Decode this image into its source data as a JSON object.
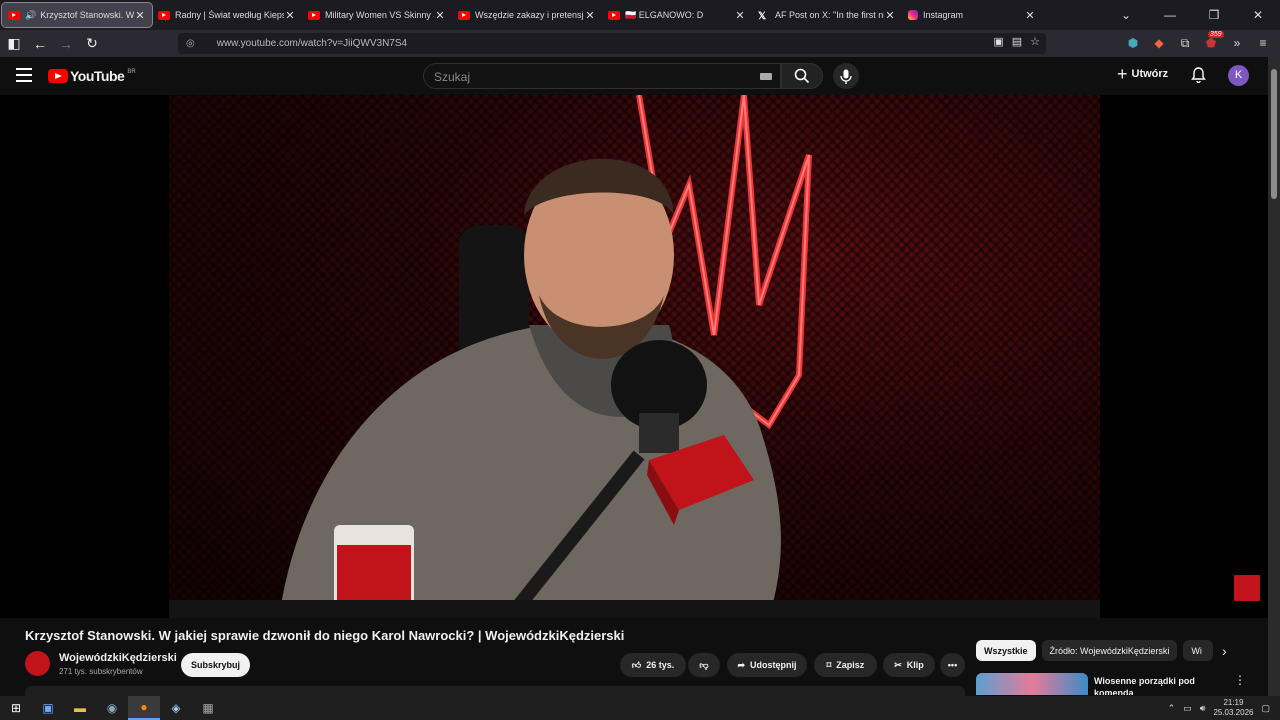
{
  "browser": {
    "tabs": [
      {
        "title": "Krzysztof Stanowski. W jaki",
        "icon": "youtube-icon",
        "active": true,
        "audio": true
      },
      {
        "title": "Radny | Świat według Kiepskich",
        "icon": "youtube-icon"
      },
      {
        "title": "Military Women VS Skinny Joes",
        "icon": "youtube-icon"
      },
      {
        "title": "Wszędzie zakazy i pretensje! Lu",
        "icon": "youtube-icon"
      },
      {
        "title": "🇵🇱 ELGANOWO: D",
        "icon": "youtube-icon"
      },
      {
        "title": "AF Post on X: \"In the first nine n",
        "icon": "x-icon"
      },
      {
        "title": "Instagram",
        "icon": "instagram-icon"
      }
    ],
    "url": "www.youtube.com/watch?v=JiiQWV3N7S4",
    "extension_badge": "359"
  },
  "youtube": {
    "logo_text": "YouTube",
    "country_code": "BR",
    "search_placeholder": "Szukaj",
    "create_label": "Utwórz",
    "avatar_letter": "K"
  },
  "video": {
    "title": "Krzysztof Stanowski. W jakiej sprawie dzwonił do niego Karol Nawrocki? | WojewódzkiKędzierski",
    "channel_name": "WojewódzkiKędzierski",
    "subscribers": "271 tys. subskrybentów",
    "subscribe_label": "Subskrybuj",
    "likes": "26 tys.",
    "share_label": "Udostępnij",
    "save_label": "Zapisz",
    "clip_label": "Klip"
  },
  "sidebar": {
    "chips": [
      "Wszystkie",
      "Źródło: WojewódzkiKędzierski",
      "Wi"
    ],
    "recommendation_title": "Wiosenne porządki pod komenda"
  },
  "taskbar": {
    "time": "21:19",
    "date": "25.03.2026"
  },
  "colors": {
    "youtube_red": "#ff0000",
    "background": "#0f0f0f",
    "avatar": "#7e57c2"
  }
}
